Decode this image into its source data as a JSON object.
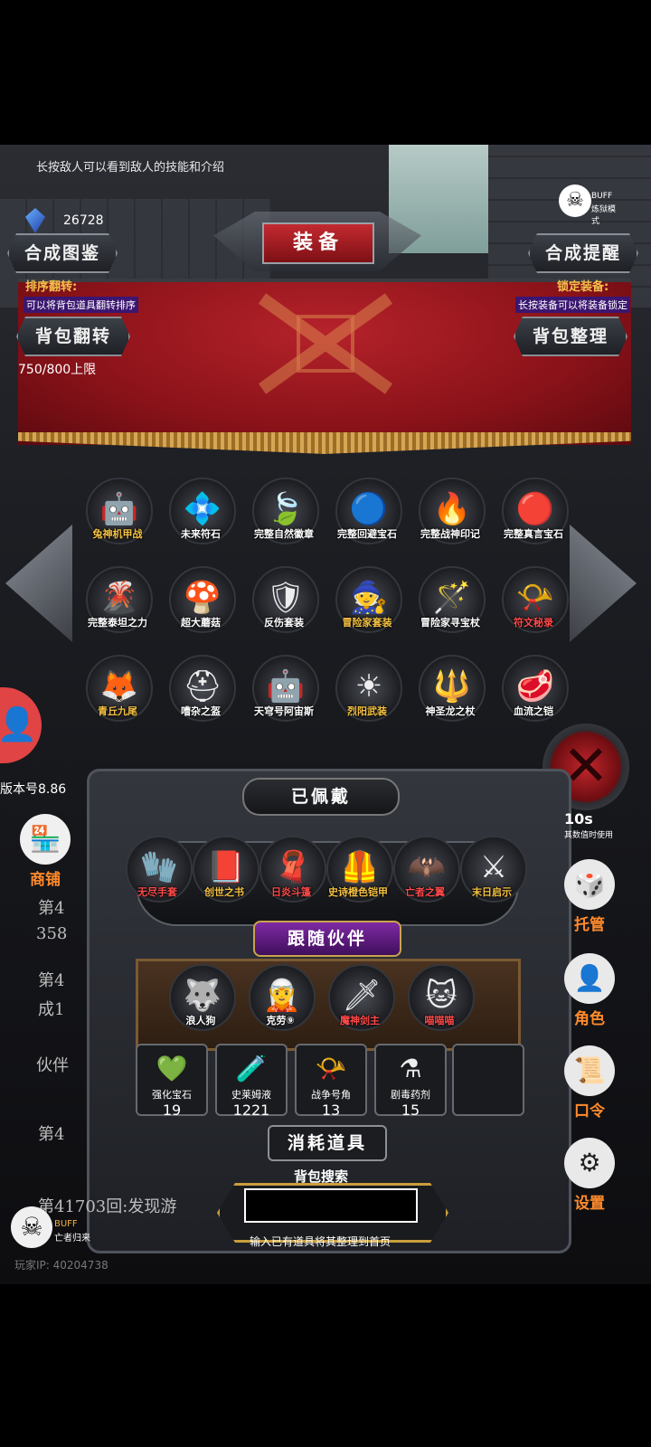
{
  "hint": "长按敌人可以看到敌人的技能和介绍",
  "currency": {
    "icon": "blue-crystal-icon",
    "amount": "26728"
  },
  "buff_top": {
    "line1": "BUFF",
    "line2": "炼狱模式"
  },
  "title": "装备",
  "buttons": {
    "synth_book": "合成图鉴",
    "synth_remind": "合成提醒",
    "bag_flip": "背包翻转",
    "bag_sort": "背包整理"
  },
  "sort_flip": {
    "label": "排序翻转:",
    "desc": "可以将背包道具翻转排序"
  },
  "lock_equip": {
    "label": "锁定装备:",
    "desc": "长按装备可以将装备锁定"
  },
  "capacity": "750/800上限",
  "inventory": [
    {
      "name": "兔神机甲战",
      "color": "#f5c242",
      "icon": "🤖"
    },
    {
      "name": "未来符石",
      "color": "#ffffff",
      "icon": "💠"
    },
    {
      "name": "完整自然徽章",
      "color": "#ffffff",
      "icon": "🍃"
    },
    {
      "name": "完整回避宝石",
      "color": "#ffffff",
      "icon": "🔵"
    },
    {
      "name": "完整战神印记",
      "color": "#ffffff",
      "icon": "🔥"
    },
    {
      "name": "完整真言宝石",
      "color": "#ffffff",
      "icon": "🔴"
    },
    {
      "name": "完整泰坦之力",
      "color": "#ffffff",
      "icon": "🌋"
    },
    {
      "name": "超大蘑菇",
      "color": "#ffffff",
      "icon": "🍄"
    },
    {
      "name": "反伤套装",
      "color": "#ffffff",
      "icon": "🛡"
    },
    {
      "name": "冒险家套装",
      "color": "#f5c242",
      "icon": "🧙"
    },
    {
      "name": "冒险家寻宝杖",
      "color": "#ffffff",
      "icon": "🪄"
    },
    {
      "name": "符文秘录",
      "color": "#ff4a4a",
      "icon": "📯"
    },
    {
      "name": "青丘九尾",
      "color": "#f5c242",
      "icon": "🦊"
    },
    {
      "name": "嘈杂之盔",
      "color": "#ffffff",
      "icon": "⛑"
    },
    {
      "name": "天穹号阿宙斯",
      "color": "#ffffff",
      "icon": "🤖"
    },
    {
      "name": "烈阳武装",
      "color": "#f5c242",
      "icon": "☀"
    },
    {
      "name": "神圣龙之杖",
      "color": "#ffffff",
      "icon": "🔱"
    },
    {
      "name": "血流之铠",
      "color": "#ffffff",
      "icon": "🥩"
    }
  ],
  "equipped_title": "已佩戴",
  "equipped": [
    {
      "name": "无尽手套",
      "color": "#ff4a4a",
      "icon": "🧤"
    },
    {
      "name": "创世之书",
      "color": "#f5c242",
      "icon": "📕"
    },
    {
      "name": "日炎斗篷",
      "color": "#ff4a4a",
      "icon": "🧣"
    },
    {
      "name": "史诗橙色铠甲",
      "color": "#f5c242",
      "icon": "🦺"
    },
    {
      "name": "亡者之翼",
      "color": "#ff4a4a",
      "icon": "🦇"
    },
    {
      "name": "末日启示",
      "color": "#f5c242",
      "icon": "⚔"
    }
  ],
  "companion_title": "跟随伙伴",
  "companions": [
    {
      "name": "浪人狗",
      "color": "#ffffff",
      "icon": "🐺"
    },
    {
      "name": "克劳⑨",
      "color": "#ffffff",
      "icon": "🧝"
    },
    {
      "name": "魔神剑主",
      "color": "#ff4a4a",
      "icon": "🗡"
    },
    {
      "name": "喵喵喵",
      "color": "#ff4a4a",
      "icon": "🐱"
    }
  ],
  "consumables": [
    {
      "name": "强化宝石",
      "count": "19",
      "icon": "💚"
    },
    {
      "name": "史莱姆液",
      "count": "1221",
      "icon": "🧪"
    },
    {
      "name": "战争号角",
      "count": "13",
      "icon": "📯"
    },
    {
      "name": "剧毒药剂",
      "count": "15",
      "icon": "⚗"
    }
  ],
  "consumables_title": "消耗道具",
  "search": {
    "label": "背包搜索",
    "hint": "输入已有道具将其整理到首页",
    "value": ""
  },
  "version": "版本号8.86",
  "side_left": {
    "shop": "商铺"
  },
  "side_right": {
    "manager": "托管",
    "role": "角色",
    "password": "口令",
    "settings": "设置",
    "counter": "10s",
    "counter_sub": "其数值时使用"
  },
  "log": {
    "l1": "第4",
    "l2": "358",
    "l3": "第4",
    "l4": "成1",
    "l5": "伙伴",
    "l6": "第4",
    "l7": "第41703回:发现游"
  },
  "buff_bottom": {
    "line1": "BUFF",
    "line2": "亡者归来"
  },
  "player_ip": "玩家IP: 40204738"
}
